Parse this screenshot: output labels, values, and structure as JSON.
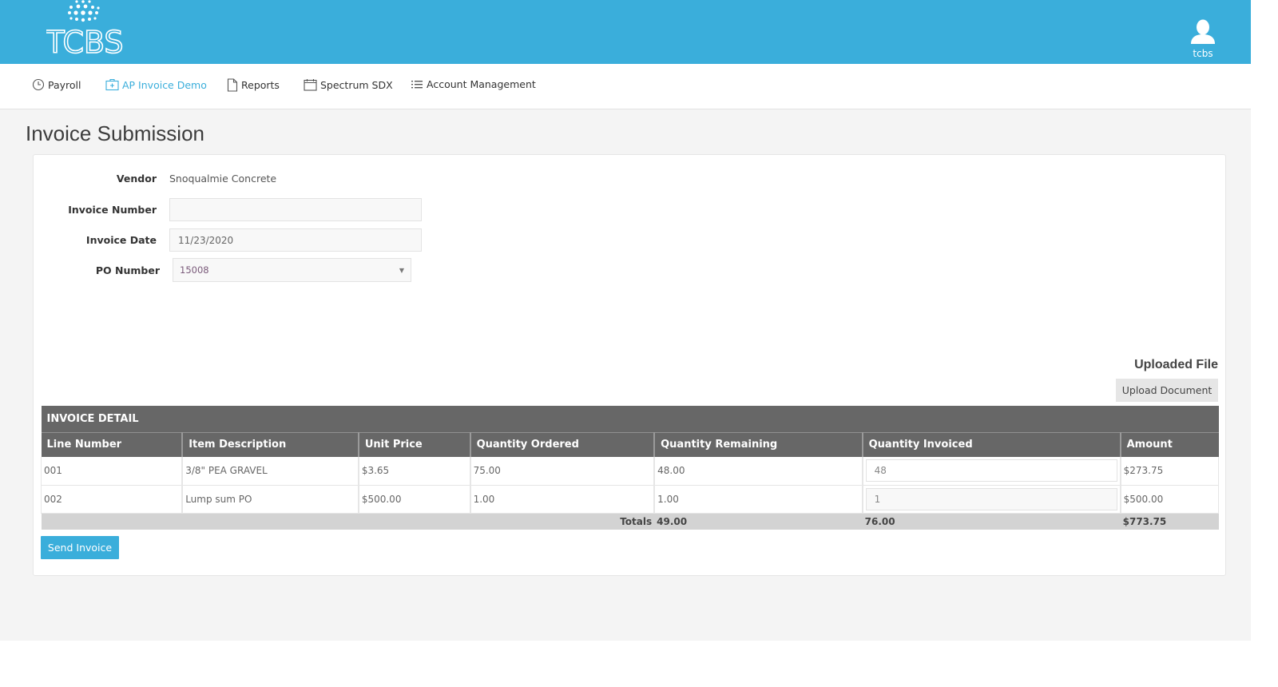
{
  "header": {
    "logo_text": "TCBS",
    "user_label": "tcbs",
    "brand_color": "#3aaedb"
  },
  "nav": {
    "items": [
      {
        "label": "Payroll",
        "icon": "clock-icon",
        "active": false
      },
      {
        "label": "AP Invoice Demo",
        "icon": "briefcase-icon",
        "active": true
      },
      {
        "label": "Reports",
        "icon": "document-icon",
        "active": false
      },
      {
        "label": "Spectrum SDX",
        "icon": "calendar-icon",
        "active": false
      },
      {
        "label": "Account Management",
        "icon": "list-icon",
        "active": false
      }
    ]
  },
  "page": {
    "title": "Invoice Submission"
  },
  "form": {
    "vendor_label": "Vendor",
    "vendor_value": "Snoqualmie Concrete",
    "invoice_number_label": "Invoice Number",
    "invoice_number_value": "",
    "invoice_date_label": "Invoice Date",
    "invoice_date_value": "11/23/2020",
    "po_number_label": "PO Number",
    "po_number_value": "15008"
  },
  "upload": {
    "heading": "Uploaded File",
    "button_label": "Upload Document"
  },
  "invoice_detail": {
    "caption": "INVOICE DETAIL",
    "columns": [
      "Line Number",
      "Item Description",
      "Unit Price",
      "Quantity Ordered",
      "Quantity Remaining",
      "Quantity Invoiced",
      "Amount"
    ],
    "rows": [
      {
        "line": "001",
        "description": "3/8\" PEA GRAVEL",
        "unit_price": "$3.65",
        "qty_ordered": "75.00",
        "qty_remaining": "48.00",
        "qty_invoiced": "48",
        "amount": "$273.75"
      },
      {
        "line": "002",
        "description": "Lump sum PO",
        "unit_price": "$500.00",
        "qty_ordered": "1.00",
        "qty_remaining": "1.00",
        "qty_invoiced": "1",
        "amount": "$500.00"
      }
    ],
    "totals": {
      "label": "Totals",
      "qty_remaining": "49.00",
      "qty_invoiced": "76.00",
      "amount": "$773.75"
    }
  },
  "actions": {
    "send_label": "Send Invoice"
  }
}
